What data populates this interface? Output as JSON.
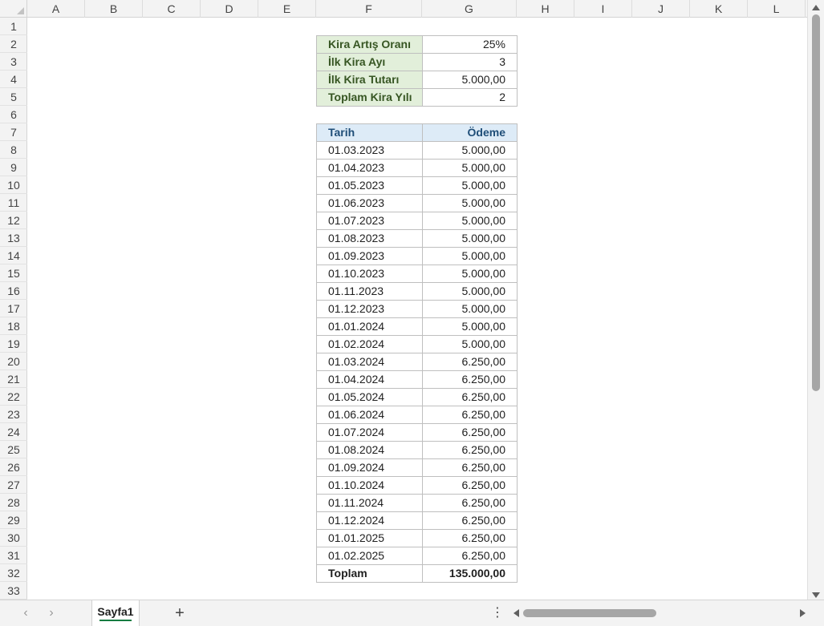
{
  "columns": [
    "A",
    "B",
    "C",
    "D",
    "E",
    "F",
    "G",
    "H",
    "I",
    "J",
    "K",
    "L"
  ],
  "rows": [
    "1",
    "2",
    "3",
    "4",
    "5",
    "6",
    "7",
    "8",
    "9",
    "10",
    "11",
    "12",
    "13",
    "14",
    "15",
    "16",
    "17",
    "18",
    "19",
    "20",
    "21",
    "22",
    "23",
    "24",
    "25",
    "26",
    "27",
    "28",
    "29",
    "30",
    "31",
    "32",
    "33"
  ],
  "parameters": [
    {
      "label": "Kira Artış Oranı",
      "value": "25%"
    },
    {
      "label": "İlk Kira Ayı",
      "value": "3"
    },
    {
      "label": "İlk Kira Tutarı",
      "value": "5.000,00"
    },
    {
      "label": "Toplam Kira Yılı",
      "value": "2"
    }
  ],
  "table": {
    "headers": [
      "Tarih",
      "Ödeme"
    ],
    "rows": [
      [
        "01.03.2023",
        "5.000,00"
      ],
      [
        "01.04.2023",
        "5.000,00"
      ],
      [
        "01.05.2023",
        "5.000,00"
      ],
      [
        "01.06.2023",
        "5.000,00"
      ],
      [
        "01.07.2023",
        "5.000,00"
      ],
      [
        "01.08.2023",
        "5.000,00"
      ],
      [
        "01.09.2023",
        "5.000,00"
      ],
      [
        "01.10.2023",
        "5.000,00"
      ],
      [
        "01.11.2023",
        "5.000,00"
      ],
      [
        "01.12.2023",
        "5.000,00"
      ],
      [
        "01.01.2024",
        "5.000,00"
      ],
      [
        "01.02.2024",
        "5.000,00"
      ],
      [
        "01.03.2024",
        "6.250,00"
      ],
      [
        "01.04.2024",
        "6.250,00"
      ],
      [
        "01.05.2024",
        "6.250,00"
      ],
      [
        "01.06.2024",
        "6.250,00"
      ],
      [
        "01.07.2024",
        "6.250,00"
      ],
      [
        "01.08.2024",
        "6.250,00"
      ],
      [
        "01.09.2024",
        "6.250,00"
      ],
      [
        "01.10.2024",
        "6.250,00"
      ],
      [
        "01.11.2024",
        "6.250,00"
      ],
      [
        "01.12.2024",
        "6.250,00"
      ],
      [
        "01.01.2025",
        "6.250,00"
      ],
      [
        "01.02.2025",
        "6.250,00"
      ]
    ],
    "total": {
      "label": "Toplam",
      "value": "135.000,00"
    }
  },
  "sheet_tabs": {
    "active": "Sayfa1",
    "add": "+",
    "options": "⋮",
    "prev": "‹",
    "next": "›"
  },
  "colors": {
    "param_fill": "#e2efda",
    "param_text": "#375623",
    "header_fill": "#ddebf7",
    "header_text": "#1f4e78",
    "active_tab_accent": "#107c41"
  }
}
